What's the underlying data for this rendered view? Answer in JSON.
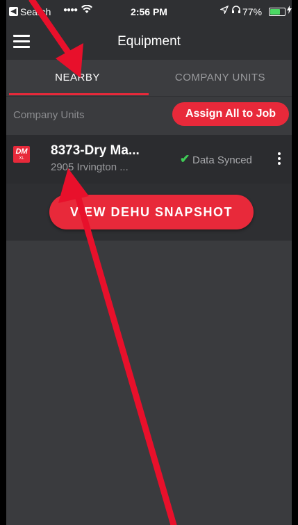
{
  "status_bar": {
    "back_glyph": "◀",
    "carrier": "Search",
    "signal_icon": "signal-icon",
    "wifi_icon": "wifi-icon",
    "time": "2:56 PM",
    "location_icon": "location-icon",
    "headphones_icon": "headphones-icon",
    "battery_percent": "77%",
    "battery_level": 0.77,
    "battery_color": "#4cd964"
  },
  "nav": {
    "menu_icon": "hamburger-menu-icon",
    "title": "Equipment"
  },
  "tabs": [
    {
      "label": "NEARBY",
      "selected": true
    },
    {
      "label": "COMPANY UNITS",
      "selected": false
    }
  ],
  "section": {
    "label": "Company Units",
    "assign_button": "Assign All to Job"
  },
  "items": [
    {
      "logo_top": "DM",
      "logo_bottom": "XL",
      "title": "8373-Dry Ma...",
      "subtitle": "2905 Irvington ...",
      "status_icon": "check-icon",
      "status": "Data Synced",
      "more_icon": "more-vertical-icon"
    }
  ],
  "snapshot_button": "VIEW DEHU SNAPSHOT",
  "colors": {
    "accent": "#e8293a",
    "background": "#3a3b3e",
    "synced_check": "#3fcb56",
    "annotation_arrow": "#e8102b"
  },
  "annotations": [
    "arrow-to-nearby-tab",
    "arrow-to-list-item"
  ]
}
